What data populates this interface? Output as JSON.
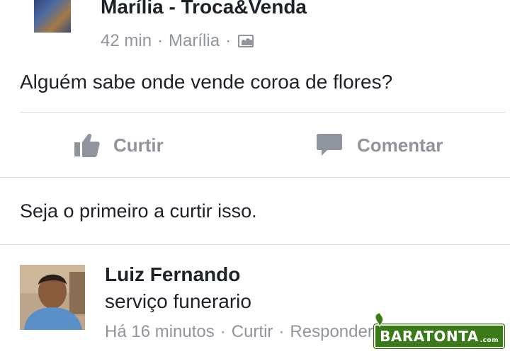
{
  "post": {
    "group_name": "Marília - Troca&Venda",
    "time": "42 min",
    "location": "Marília",
    "separator": "·",
    "audience_icon": "group-icon",
    "text": "Alguém sabe onde vende coroa de flores?"
  },
  "actions": {
    "like_label": "Curtir",
    "like_icon": "thumbs-up-icon",
    "comment_label": "Comentar",
    "comment_icon": "comment-icon"
  },
  "likes": {
    "text": "Seja o primeiro a curtir isso."
  },
  "comment": {
    "author": "Luiz Fernando",
    "text": "serviço funerario",
    "time": "Há 16 minutos",
    "like_label": "Curtir",
    "reply_label": "Responder",
    "separator": "·"
  },
  "watermark": {
    "text": "BARATONTA",
    "suffix": ".com"
  },
  "colors": {
    "text": "#1d2129",
    "secondary": "#90949c",
    "divider": "#dddfe2",
    "watermark_green": "#3a7a18"
  }
}
